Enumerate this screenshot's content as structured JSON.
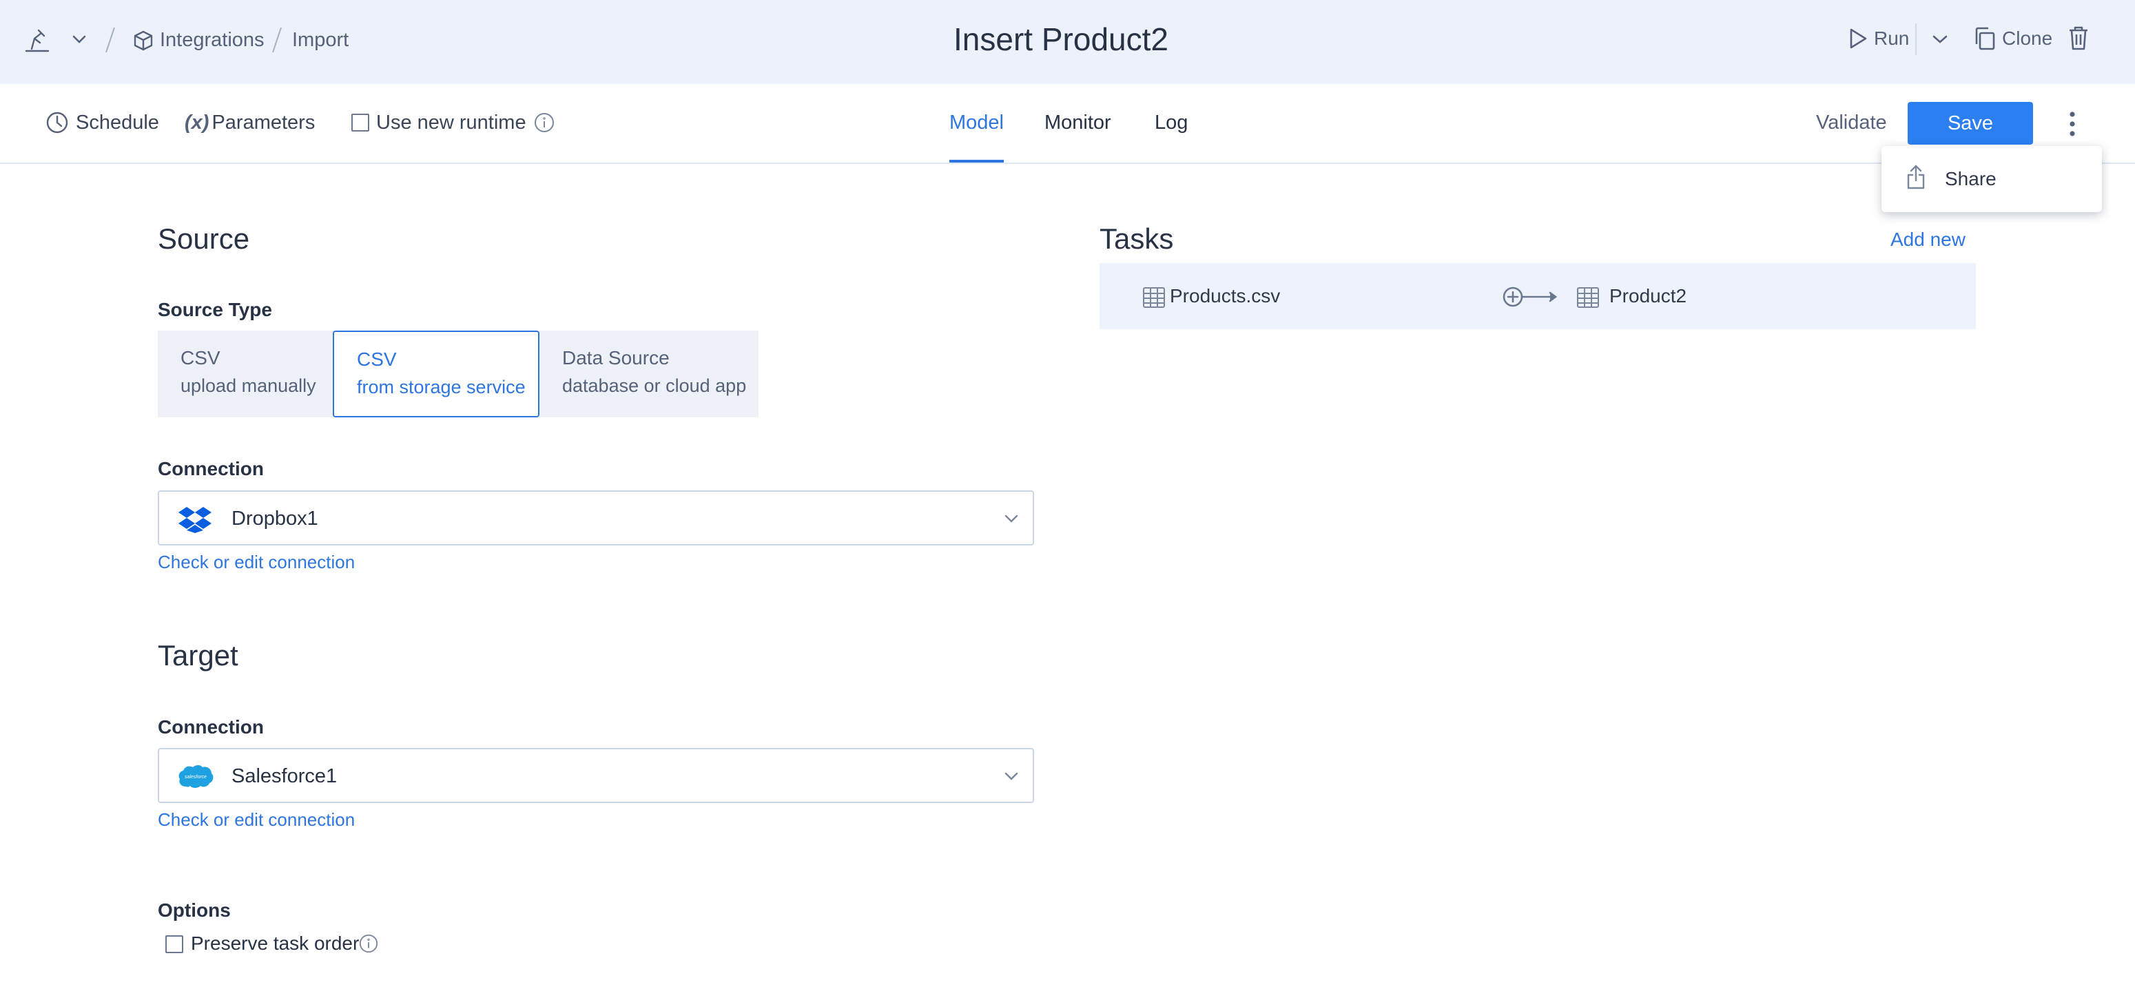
{
  "header": {
    "breadcrumb": [
      "Integrations",
      "Import"
    ],
    "title": "Insert Product2",
    "run_label": "Run",
    "clone_label": "Clone"
  },
  "toolbar": {
    "schedule_label": "Schedule",
    "parameters_label": "Parameters",
    "parameters_icon_text": "(x)",
    "use_new_runtime_label": "Use new runtime",
    "use_new_runtime_checked": false,
    "tabs": [
      {
        "label": "Model",
        "active": true
      },
      {
        "label": "Monitor",
        "active": false
      },
      {
        "label": "Log",
        "active": false
      }
    ],
    "validate_label": "Validate",
    "save_label": "Save"
  },
  "dropdown_menu": {
    "items": [
      {
        "label": "Share",
        "icon": "share-icon"
      }
    ]
  },
  "source": {
    "heading": "Source",
    "source_type_label": "Source Type",
    "source_types": [
      {
        "title": "CSV",
        "subtitle": "upload manually",
        "selected": false
      },
      {
        "title": "CSV",
        "subtitle": "from storage service",
        "selected": true
      },
      {
        "title": "Data Source",
        "subtitle": "database or cloud app",
        "selected": false
      }
    ],
    "connection_label": "Connection",
    "connection_value": "Dropbox1",
    "connection_icon": "dropbox-icon",
    "check_link": "Check or edit connection"
  },
  "target": {
    "heading": "Target",
    "connection_label": "Connection",
    "connection_value": "Salesforce1",
    "connection_icon": "salesforce-icon",
    "check_link": "Check or edit connection"
  },
  "options": {
    "label": "Options",
    "preserve_task_order_label": "Preserve task order",
    "preserve_task_order_checked": false
  },
  "tasks": {
    "heading": "Tasks",
    "add_new_label": "Add new",
    "items": [
      {
        "source": "Products.csv",
        "target": "Product2"
      }
    ]
  },
  "colors": {
    "accent": "#2d76e0",
    "save_button": "#2b7ff0",
    "header_bg": "#edf1f9",
    "salesforce": "#1ea1e0",
    "dropbox": "#0a5fe0"
  }
}
